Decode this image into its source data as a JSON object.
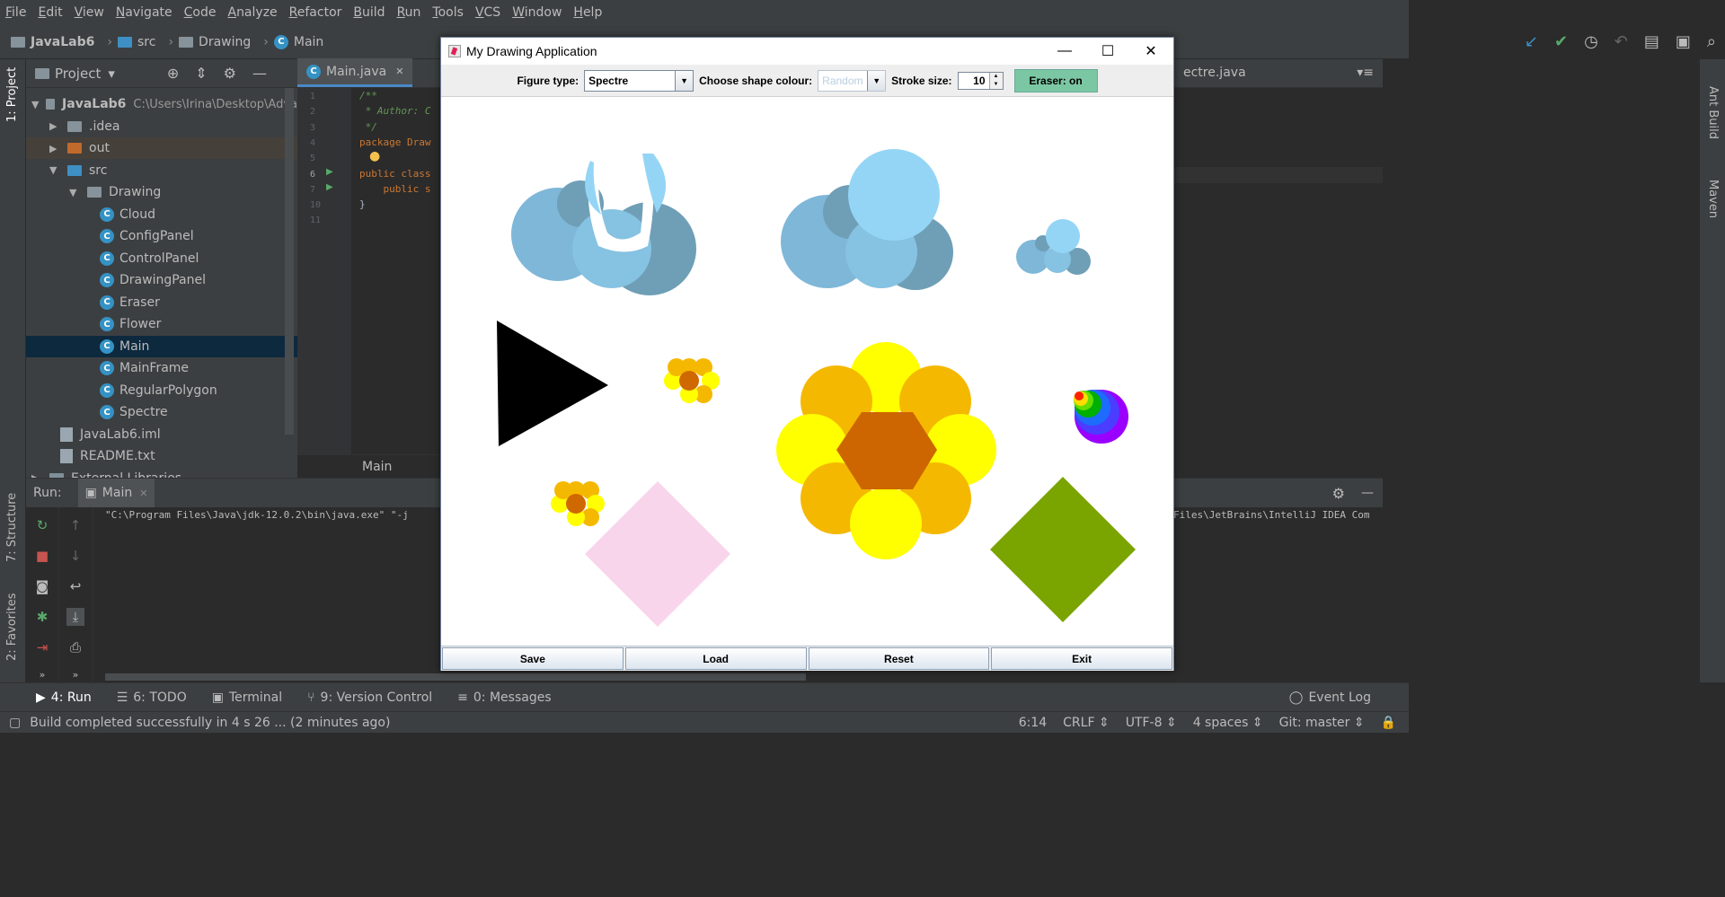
{
  "menu": [
    "File",
    "Edit",
    "View",
    "Navigate",
    "Code",
    "Analyze",
    "Refactor",
    "Build",
    "Run",
    "Tools",
    "VCS",
    "Window",
    "Help"
  ],
  "breadcrumb": {
    "project": "JavaLab6",
    "folder1": "src",
    "folder2": "Drawing",
    "file": "Main"
  },
  "project_panel": {
    "title": "Project",
    "tab_label": "1: Project",
    "tree": [
      {
        "label": "JavaLab6",
        "path": "C:\\Users\\Irina\\Desktop\\Adva"
      },
      {
        "label": ".idea"
      },
      {
        "label": "out"
      },
      {
        "label": "src"
      },
      {
        "label": "Drawing"
      },
      {
        "label": "Cloud"
      },
      {
        "label": "ConfigPanel"
      },
      {
        "label": "ControlPanel"
      },
      {
        "label": "DrawingPanel"
      },
      {
        "label": "Eraser"
      },
      {
        "label": "Flower"
      },
      {
        "label": "Main"
      },
      {
        "label": "MainFrame"
      },
      {
        "label": "RegularPolygon"
      },
      {
        "label": "Spectre"
      },
      {
        "label": "JavaLab6.iml"
      },
      {
        "label": "README.txt"
      },
      {
        "label": "External Libraries"
      }
    ]
  },
  "editor": {
    "tab": "Main.java",
    "right_tab": "ectre.java",
    "line_numbers": [
      "1",
      "2",
      "3",
      "4",
      "5",
      "6",
      "7",
      "10",
      "11"
    ],
    "code": [
      "/**",
      " * Author: C",
      " */",
      "package Draw",
      "",
      "public class",
      "    public s",
      "}",
      ""
    ],
    "breadcrumb": "Main"
  },
  "left_strip": {
    "structure": "7: Structure",
    "favorites": "2: Favorites"
  },
  "right_strip": {
    "ant": "Ant Build",
    "maven": "Maven"
  },
  "run_panel": {
    "label": "Run:",
    "tab": "Main",
    "console_left": "\"C:\\Program Files\\Java\\jdk-12.0.2\\bin\\java.exe\" \"-j",
    "console_right": "Files\\JetBrains\\IntelliJ IDEA Com"
  },
  "bottom_tools": [
    {
      "label": "4: Run",
      "icon": "play-icon"
    },
    {
      "label": "6: TODO",
      "icon": "list-icon"
    },
    {
      "label": "Terminal",
      "icon": "terminal-icon"
    },
    {
      "label": "9: Version Control",
      "icon": "vcs-icon"
    },
    {
      "label": "0: Messages",
      "icon": "messages-icon"
    }
  ],
  "event_log": "Event Log",
  "status": {
    "message": "Build completed successfully in 4 s 26 ... (2 minutes ago)",
    "position": "6:14",
    "line_sep": "CRLF",
    "encoding": "UTF-8",
    "indent": "4 spaces",
    "git": "Git: master"
  },
  "app": {
    "title": "My Drawing Application",
    "figure_type_label": "Figure type:",
    "figure_type_value": "Spectre",
    "colour_label": "Choose shape colour:",
    "colour_value": "Random",
    "stroke_label": "Stroke size:",
    "stroke_value": "10",
    "eraser_button": "Eraser: on",
    "buttons": [
      "Save",
      "Load",
      "Reset",
      "Exit"
    ]
  }
}
